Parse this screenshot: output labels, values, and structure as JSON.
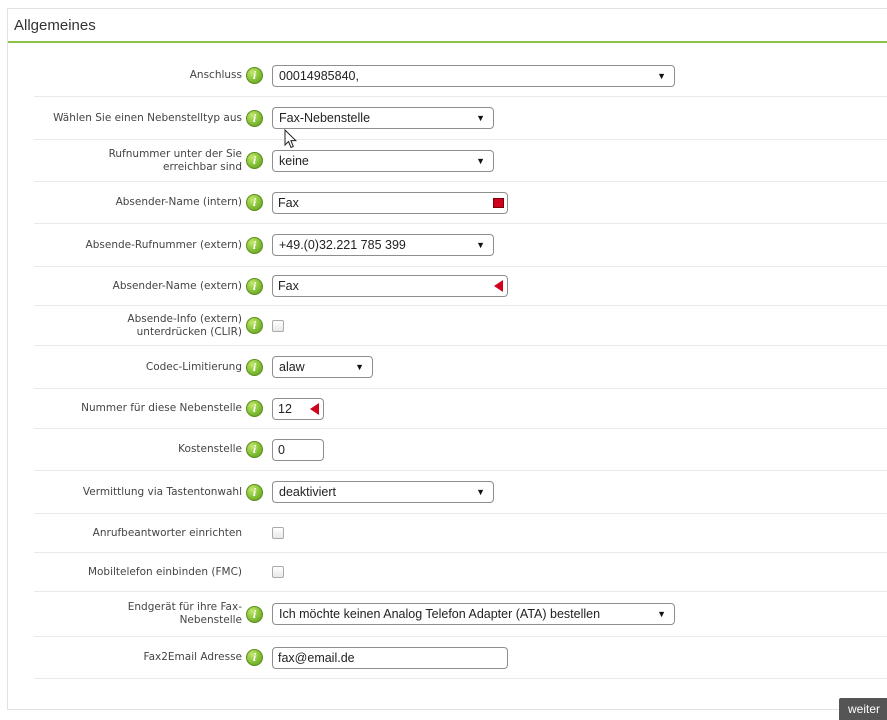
{
  "panel": {
    "title": "Allgemeines"
  },
  "fields": {
    "anschluss": {
      "label": "Anschluss",
      "value": "00014985840,"
    },
    "nebenstelltyp": {
      "label": "Wählen Sie einen Nebenstelltyp aus",
      "value": "Fax-Nebenstelle"
    },
    "rufnummer": {
      "label": "Rufnummer unter der Sie erreichbar sind",
      "value": "keine"
    },
    "absender_intern": {
      "label": "Absender-Name (intern)",
      "value": "Fax"
    },
    "absende_rufnummer": {
      "label": "Absende-Rufnummer (extern)",
      "value": "+49.(0)32.221 785 399"
    },
    "absender_extern": {
      "label": "Absender-Name (extern)",
      "value": "Fax"
    },
    "clir": {
      "label": "Absende-Info (extern) unterdrücken (CLIR)"
    },
    "codec": {
      "label": "Codec-Limitierung",
      "value": "alaw"
    },
    "nummer": {
      "label": "Nummer für diese Nebenstelle",
      "value": "12"
    },
    "kostenstelle": {
      "label": "Kostenstelle",
      "value": "0"
    },
    "vermittlung": {
      "label": "Vermittlung via Tastentonwahl",
      "value": "deaktiviert"
    },
    "anrufbeantworter": {
      "label": "Anrufbeantworter einrichten"
    },
    "fmc": {
      "label": "Mobiltelefon einbinden (FMC)"
    },
    "endgeraet": {
      "label": "Endgerät für ihre Fax-Nebenstelle",
      "value": "Ich möchte keinen Analog Telefon Adapter (ATA) bestellen"
    },
    "fax2email": {
      "label": "Fax2Email Adresse",
      "value": "fax@email.de"
    }
  },
  "buttons": {
    "next": "weiter"
  },
  "icons": {
    "info": "i",
    "dropdown": "▼"
  },
  "colors": {
    "accent": "#8bc34a",
    "required": "#d0021b",
    "button": "#555555"
  }
}
